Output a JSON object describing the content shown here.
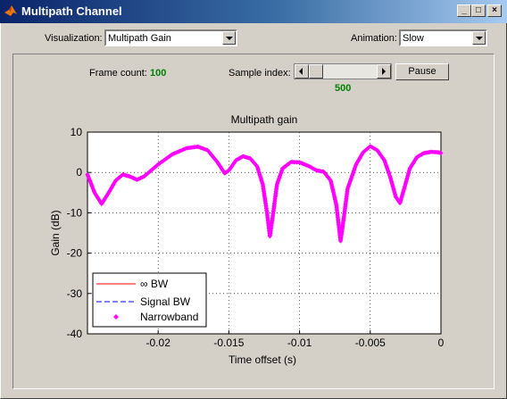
{
  "window": {
    "title": "Multipath Channel",
    "minimize": "_",
    "maximize": "□",
    "close": "×"
  },
  "controls": {
    "visualization_label": "Visualization:",
    "visualization_value": "Multipath Gain",
    "animation_label": "Animation:",
    "animation_value": "Slow",
    "frame_count_label": "Frame count:",
    "frame_count_value": "100",
    "sample_index_label": "Sample index:",
    "sample_index_value": "500",
    "slider_position": 0.0,
    "pause_label": "Pause"
  },
  "chart_data": {
    "type": "scatter",
    "title": "Multipath gain",
    "xlabel": "Time offset (s)",
    "ylabel": "Gain (dB)",
    "xlim": [
      -0.025,
      0
    ],
    "ylim": [
      -40,
      10
    ],
    "xticks": [
      -0.02,
      -0.015,
      -0.01,
      -0.005,
      0
    ],
    "xtick_labels": [
      "-0.02",
      "-0.015",
      "-0.01",
      "-0.005",
      "0"
    ],
    "yticks": [
      10,
      0,
      -10,
      -20,
      -30,
      -40
    ],
    "ytick_labels": [
      "10",
      "0",
      "-10",
      "-20",
      "-30",
      "-40"
    ],
    "grid": true,
    "legend_position": "lower-left",
    "colors": {
      "narrowband": "#ff00ff",
      "infinite_bw": "#ff0000",
      "signal_bw": "#0000ff"
    },
    "series": [
      {
        "name": "∞ BW",
        "style": "line",
        "values": []
      },
      {
        "name": "Signal BW",
        "style": "dashed",
        "values": []
      },
      {
        "name": "Narrowband",
        "style": "markers",
        "points": [
          [
            -0.025,
            -0.5
          ],
          [
            -0.0245,
            -5
          ],
          [
            -0.024,
            -7.8
          ],
          [
            -0.0235,
            -5
          ],
          [
            -0.023,
            -2
          ],
          [
            -0.0225,
            -0.5
          ],
          [
            -0.022,
            -1
          ],
          [
            -0.0215,
            -1.8
          ],
          [
            -0.021,
            -1
          ],
          [
            -0.02,
            2
          ],
          [
            -0.019,
            4.5
          ],
          [
            -0.018,
            6
          ],
          [
            -0.0172,
            6.4
          ],
          [
            -0.0165,
            5.5
          ],
          [
            -0.0158,
            2.5
          ],
          [
            -0.0153,
            -0.2
          ],
          [
            -0.015,
            0.5
          ],
          [
            -0.0145,
            3
          ],
          [
            -0.014,
            4
          ],
          [
            -0.0135,
            3.5
          ],
          [
            -0.013,
            1.5
          ],
          [
            -0.0126,
            -3
          ],
          [
            -0.0123,
            -10
          ],
          [
            -0.0121,
            -15.8
          ],
          [
            -0.0119,
            -11
          ],
          [
            -0.0116,
            -3
          ],
          [
            -0.0112,
            1
          ],
          [
            -0.0106,
            2.6
          ],
          [
            -0.01,
            2.5
          ],
          [
            -0.0093,
            1.5
          ],
          [
            -0.0088,
            0.5
          ],
          [
            -0.0083,
            0.2
          ],
          [
            -0.0078,
            -2
          ],
          [
            -0.0074,
            -8
          ],
          [
            -0.0071,
            -17
          ],
          [
            -0.0069,
            -12
          ],
          [
            -0.0066,
            -4
          ],
          [
            -0.006,
            2
          ],
          [
            -0.0055,
            5
          ],
          [
            -0.005,
            6.5
          ],
          [
            -0.0045,
            5.5
          ],
          [
            -0.004,
            3
          ],
          [
            -0.0036,
            -1
          ],
          [
            -0.0032,
            -6
          ],
          [
            -0.0029,
            -7.6
          ],
          [
            -0.0026,
            -4
          ],
          [
            -0.0022,
            1
          ],
          [
            -0.0017,
            3.8
          ],
          [
            -0.0012,
            4.8
          ],
          [
            -0.0007,
            5.1
          ],
          [
            -0.0002,
            5
          ],
          [
            0,
            4.8
          ]
        ]
      }
    ]
  }
}
